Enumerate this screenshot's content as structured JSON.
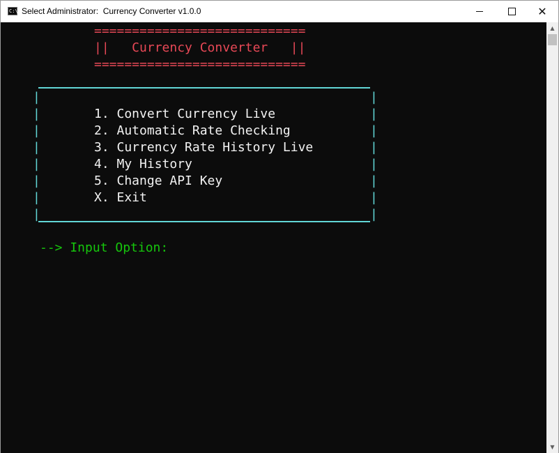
{
  "window": {
    "title": "Select Administrator:  Currency Converter v1.0.0",
    "icon": "console-icon",
    "minimize_glyph": "",
    "close_glyph": "✕"
  },
  "header": {
    "rule_top": "============================",
    "title_line": "||   Currency Converter   ||",
    "rule_bottom": "============================"
  },
  "menu": {
    "items": [
      "1. Convert Currency Live",
      "2. Automatic Rate Checking",
      "3. Currency Rate History Live",
      "4. My History",
      "5. Change API Key",
      "X. Exit"
    ],
    "border_left": "|\n|\n|\n|\n|\n|\n|\n|",
    "border_right": "|\n|\n|\n|\n|\n|\n|\n|"
  },
  "prompt": {
    "text": "--> Input Option:"
  },
  "scrollbar": {
    "up_arrow": "▲",
    "down_arrow": "▼"
  },
  "colors": {
    "background": "#0c0c0c",
    "header_red": "#e74856",
    "menu_white": "#f2f2f2",
    "box_cyan": "#61d6d6",
    "prompt_green": "#16c60c"
  }
}
